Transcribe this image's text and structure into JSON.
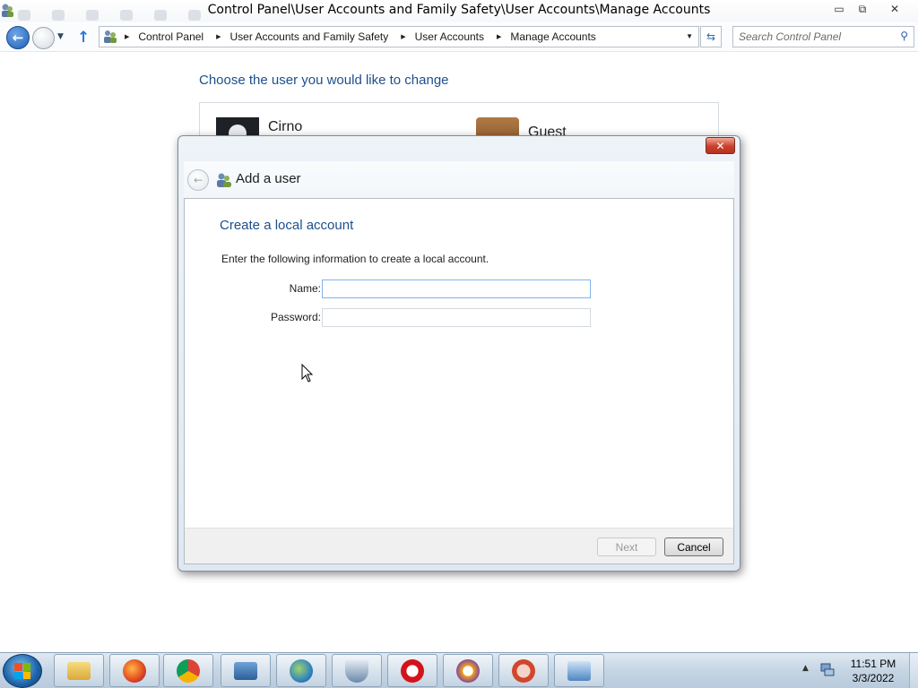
{
  "window": {
    "title": "Control Panel\\User Accounts and Family Safety\\User Accounts\\Manage Accounts",
    "minimize_label": "▭",
    "maximize_label": "⧉",
    "close_label": "✕"
  },
  "navbar": {
    "breadcrumbs": [
      "Control Panel",
      "User Accounts and Family Safety",
      "User Accounts",
      "Manage Accounts"
    ],
    "search_placeholder": "Search Control Panel"
  },
  "content": {
    "heading": "Choose the user you would like to change",
    "users": [
      {
        "name": "Cirno"
      },
      {
        "name": "Guest"
      }
    ]
  },
  "dialog": {
    "title": "Add a user",
    "close_label": "✕",
    "heading": "Create a local account",
    "instructions": "Enter the following information to create a local account.",
    "fields": {
      "name_label": "Name:",
      "name_value": "",
      "password_label": "Password:",
      "password_value": ""
    },
    "buttons": {
      "next": "Next",
      "cancel": "Cancel"
    }
  },
  "taskbar": {
    "apps": [
      "file-explorer",
      "firefox",
      "chrome",
      "remote-desktop",
      "network-globe",
      "security-shield",
      "opera",
      "vpn-lock",
      "antivirus",
      "control-panel"
    ],
    "clock": {
      "time": "11:51 PM",
      "date": "3/3/2022"
    }
  },
  "colors": {
    "accent_heading": "#1d4f8c",
    "dialog_close": "#c8412e",
    "taskbar": "#c5d5e4"
  }
}
